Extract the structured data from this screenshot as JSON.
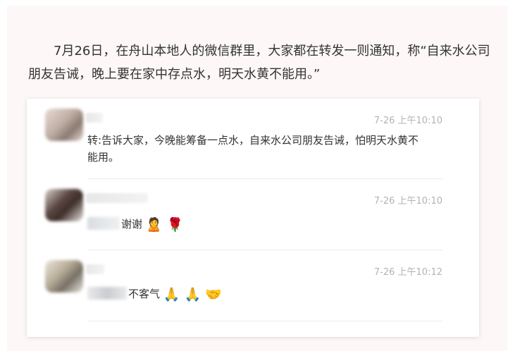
{
  "article": {
    "paragraph": "7月26日，在舟山本地人的微信群里，大家都在转发一则通知，称“自来水公司朋友告诫，晚上要在家中存点水，明天水黄不能用。”"
  },
  "chat": {
    "messages": [
      {
        "time": "7-26 上午10:10",
        "text": "转:告诉大家，今晚能筹备一点水，自来水公司朋友告诫，怕明天水黄不能用。"
      },
      {
        "time": "7-26 上午10:10",
        "text": "谢谢",
        "emojis": "🙎 🌹",
        "emoji_icons": [
          "person-pouting-icon",
          "rose-icon"
        ]
      },
      {
        "time": "7-26 上午10:12",
        "text": "不客气",
        "emojis": "🙏 🙏 🤝",
        "emoji_icons": [
          "folded-hands-icon",
          "folded-hands-icon",
          "handshake-icon"
        ]
      }
    ]
  },
  "colors": {
    "page_background": "#fdf7f7",
    "text": "#333333",
    "timestamp": "#b3b3b3",
    "card": "#ffffff"
  }
}
